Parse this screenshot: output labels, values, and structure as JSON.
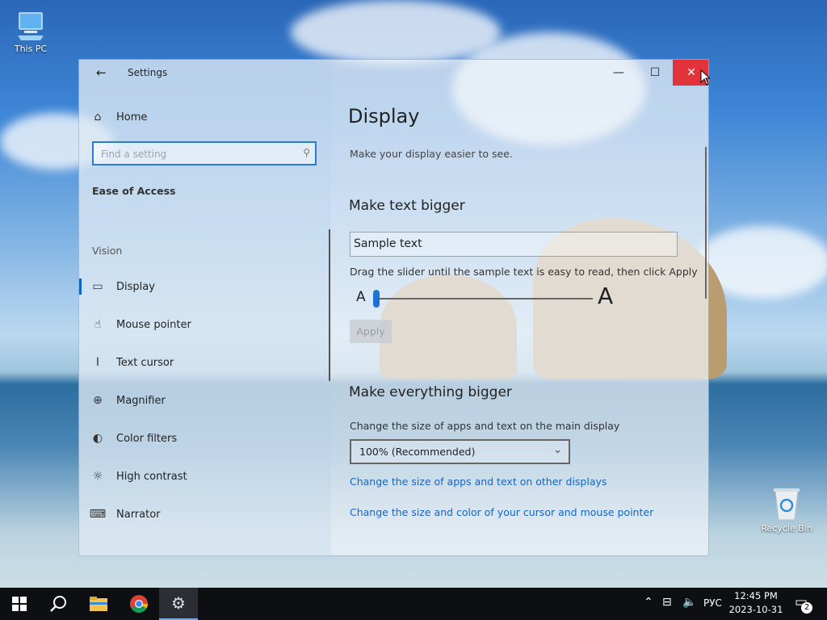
{
  "desktop": {
    "icons": [
      {
        "label": "This PC"
      },
      {
        "label": "Recycle Bin"
      }
    ]
  },
  "window": {
    "title": "Settings",
    "controls": {
      "minimize": "—",
      "maximize": "☐",
      "close": "✕"
    },
    "sidebar": {
      "home_label": "Home",
      "search_placeholder": "Find a setting",
      "section_title": "Ease of Access",
      "group_title": "Vision",
      "items": [
        {
          "label": "Display",
          "icon": "display-icon",
          "selected": true
        },
        {
          "label": "Mouse pointer",
          "icon": "mouse-pointer-icon"
        },
        {
          "label": "Text cursor",
          "icon": "text-cursor-icon"
        },
        {
          "label": "Magnifier",
          "icon": "magnifier-icon"
        },
        {
          "label": "Color filters",
          "icon": "color-filters-icon"
        },
        {
          "label": "High contrast",
          "icon": "high-contrast-icon"
        },
        {
          "label": "Narrator",
          "icon": "narrator-icon"
        }
      ]
    },
    "main": {
      "title": "Display",
      "subtitle": "Make your display easier to see.",
      "text_section": {
        "heading": "Make text bigger",
        "sample_text": "Sample text",
        "instructions": "Drag the slider until the sample text is easy to read, then click Apply",
        "slider_min_label": "A",
        "slider_max_label": "A",
        "slider_value": 0,
        "apply_label": "Apply"
      },
      "everything_section": {
        "heading": "Make everything bigger",
        "description": "Change the size of apps and text on the main display",
        "scale_selected": "100% (Recommended)",
        "link_other_displays": "Change the size of apps and text on other displays",
        "link_cursor": "Change the size and color of your cursor and mouse pointer"
      }
    }
  },
  "taskbar": {
    "language": "РУС",
    "time": "12:45 PM",
    "date": "2023-10-31",
    "notification_count": "2"
  }
}
